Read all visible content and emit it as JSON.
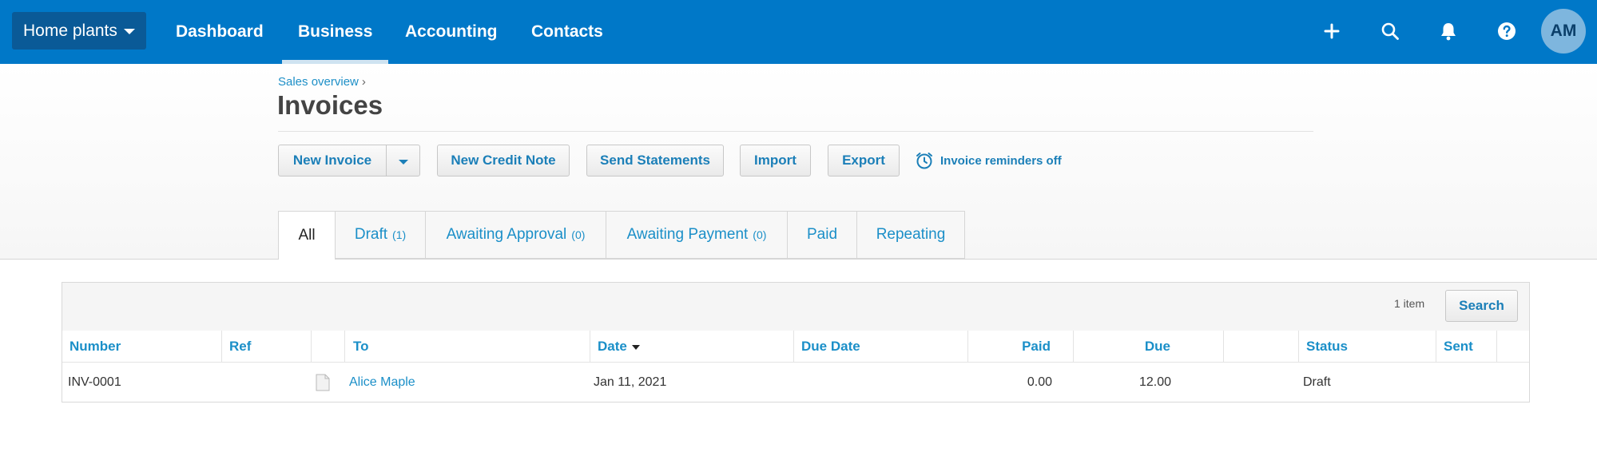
{
  "topnav": {
    "org_name": "Home plants",
    "items": [
      {
        "label": "Dashboard"
      },
      {
        "label": "Business"
      },
      {
        "label": "Accounting"
      },
      {
        "label": "Contacts"
      }
    ],
    "active_item": "Business",
    "icons": [
      "plus-icon",
      "search-icon",
      "bell-icon",
      "help-icon"
    ],
    "avatar_initials": "AM",
    "colors": {
      "bar": "#0078c8",
      "org_button": "#0a5a97",
      "avatar": "#7eb6de"
    }
  },
  "header": {
    "breadcrumb": "Sales overview",
    "breadcrumb_sep": "›",
    "title": "Invoices"
  },
  "toolbar": {
    "new_invoice": "New Invoice",
    "new_credit_note": "New Credit Note",
    "send_statements": "Send Statements",
    "import": "Import",
    "export": "Export",
    "reminders": "Invoice reminders off"
  },
  "tabs": [
    {
      "label": "All",
      "count": ""
    },
    {
      "label": "Draft",
      "count": "(1)"
    },
    {
      "label": "Awaiting Approval",
      "count": "(0)"
    },
    {
      "label": "Awaiting Payment",
      "count": "(0)"
    },
    {
      "label": "Paid",
      "count": ""
    },
    {
      "label": "Repeating",
      "count": ""
    }
  ],
  "active_tab": "All",
  "table": {
    "item_count": "1 item",
    "search_label": "Search",
    "columns": [
      "Number",
      "Ref",
      "",
      "To",
      "Date",
      "Due Date",
      "Paid",
      "Due",
      "",
      "Status",
      "Sent"
    ],
    "sorted_column": "Date",
    "rows": [
      {
        "number": "INV-0001",
        "ref": "",
        "to": "Alice Maple",
        "date": "Jan 11, 2021",
        "due_date": "",
        "paid": "0.00",
        "due": "12.00",
        "status": "Draft",
        "sent": ""
      }
    ]
  },
  "accent_color": "#1b8fc8"
}
